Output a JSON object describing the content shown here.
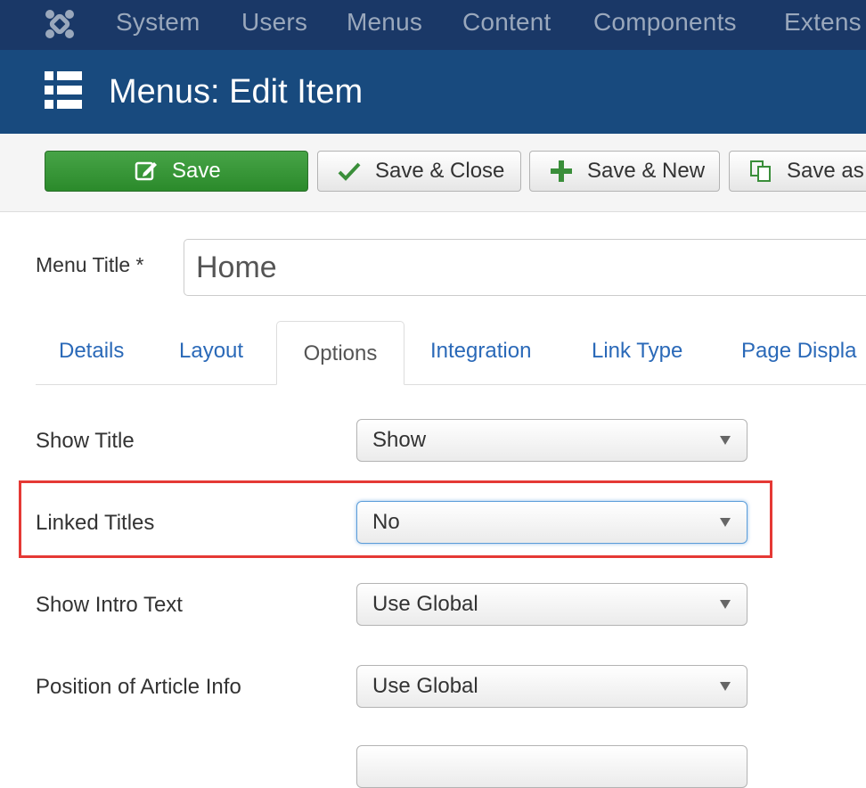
{
  "navbar": {
    "items": [
      "System",
      "Users",
      "Menus",
      "Content",
      "Components",
      "Extens"
    ]
  },
  "header": {
    "title": "Menus: Edit Item"
  },
  "toolbar": {
    "save_label": "Save",
    "save_close_label": "Save & Close",
    "save_new_label": "Save & New",
    "save_copy_label": "Save as"
  },
  "form": {
    "menu_title_label": "Menu Title *",
    "menu_title_value": "Home"
  },
  "tabs": [
    "Details",
    "Layout",
    "Options",
    "Integration",
    "Link Type",
    "Page Displa"
  ],
  "active_tab": "Options",
  "options": [
    {
      "label": "Show Title",
      "value": "Show"
    },
    {
      "label": "Linked Titles",
      "value": "No"
    },
    {
      "label": "Show Intro Text",
      "value": "Use Global"
    },
    {
      "label": "Position of Article Info",
      "value": "Use Global"
    }
  ],
  "colors": {
    "navbar": "#1a3867",
    "header": "#184a7e",
    "save_button": "#3b9b3b",
    "tab_link": "#2a69b8",
    "highlight": "#e53935"
  }
}
